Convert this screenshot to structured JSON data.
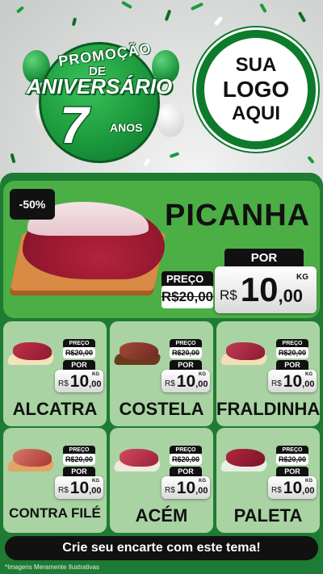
{
  "header": {
    "promo_word": "PROMOÇÃO",
    "de_word": "DE",
    "anniversary_word": "ANIVERSÁRIO",
    "years_number": "7",
    "years_word": "ANOS",
    "logo_line1": "SUA",
    "logo_line2": "LOGO",
    "logo_line3": "AQUI"
  },
  "featured": {
    "discount_badge": "-50%",
    "name": "PICANHA",
    "por_label": "POR",
    "preco_label": "PREÇO",
    "old_price": "R$20,00",
    "currency": "R$",
    "price_int": "10",
    "price_dec": ",00",
    "unit": "KG"
  },
  "products": [
    {
      "name": "ALCATRA",
      "preco_label": "PREÇO",
      "old_price": "R$20,00",
      "por_label": "POR",
      "currency": "R$",
      "price_int": "10",
      "price_dec": ",00",
      "unit": "KG"
    },
    {
      "name": "COSTELA",
      "preco_label": "PREÇO",
      "old_price": "R$20,00",
      "por_label": "POR",
      "currency": "R$",
      "price_int": "10",
      "price_dec": ",00",
      "unit": "KG"
    },
    {
      "name": "FRALDINHA",
      "preco_label": "PREÇO",
      "old_price": "R$20,00",
      "por_label": "POR",
      "currency": "R$",
      "price_int": "10",
      "price_dec": ",00",
      "unit": "KG"
    },
    {
      "name": "CONTRA FILÉ",
      "preco_label": "PREÇO",
      "old_price": "R$20,00",
      "por_label": "POR",
      "currency": "R$",
      "price_int": "10",
      "price_dec": ",00",
      "unit": "KG"
    },
    {
      "name": "ACÉM",
      "preco_label": "PREÇO",
      "old_price": "R$20,00",
      "por_label": "POR",
      "currency": "R$",
      "price_int": "10",
      "price_dec": ",00",
      "unit": "KG"
    },
    {
      "name": "PALETA",
      "preco_label": "PREÇO",
      "old_price": "R$20,00",
      "por_label": "POR",
      "currency": "R$",
      "price_int": "10",
      "price_dec": ",00",
      "unit": "KG"
    }
  ],
  "cta": "Crie seu encarte com este tema!",
  "disclaimer": "*Imagens Meramente Ilustrativas",
  "colors": {
    "dark_green": "#1e7b33",
    "hero_green": "#4caf45",
    "card_green": "#a9d3a3",
    "black": "#111111"
  }
}
